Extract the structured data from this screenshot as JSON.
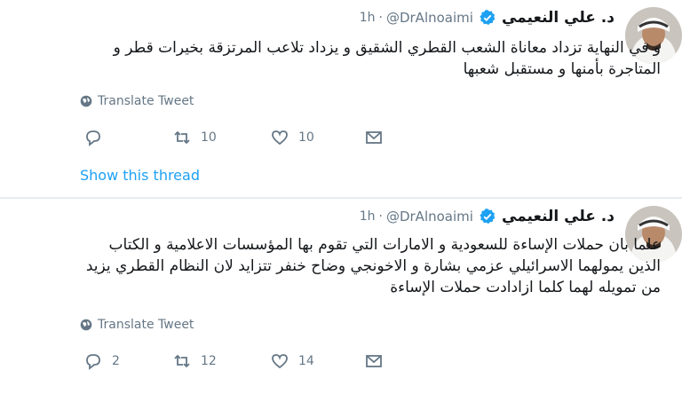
{
  "colors": {
    "accent": "#1da1f2",
    "muted": "#657786",
    "text": "#14171a",
    "divider": "#e6ecf0"
  },
  "tweets": [
    {
      "name": "د. علي النعيمي",
      "handle": "@DrAlnoaimi",
      "separator": "·",
      "time": "1h",
      "text": "و في النهاية تزداد معاناة الشعب القطري الشقيق و يزداد تلاعب المرتزقة بخيرات قطر و المتاجرة بأمنها و مستقبل شعبها",
      "translate": "Translate Tweet",
      "reply_count": "",
      "retweet_count": "10",
      "like_count": "10",
      "show_thread": "Show this thread"
    },
    {
      "name": "د. علي النعيمي",
      "handle": "@DrAlnoaimi",
      "separator": "·",
      "time": "1h",
      "text": "علما بان حملات الإساءة للسعودية و الامارات التي تقوم بها المؤسسات الاعلامية و الكتاب الذين يمولهما الاسرائيلي عزمي بشارة و الاخونجي وضاح خنفر تتزايد لان النظام القطري يزيد من تمويله لهما كلما ازادادت حملات الإساءة",
      "translate": "Translate Tweet",
      "reply_count": "2",
      "retweet_count": "12",
      "like_count": "14"
    }
  ]
}
